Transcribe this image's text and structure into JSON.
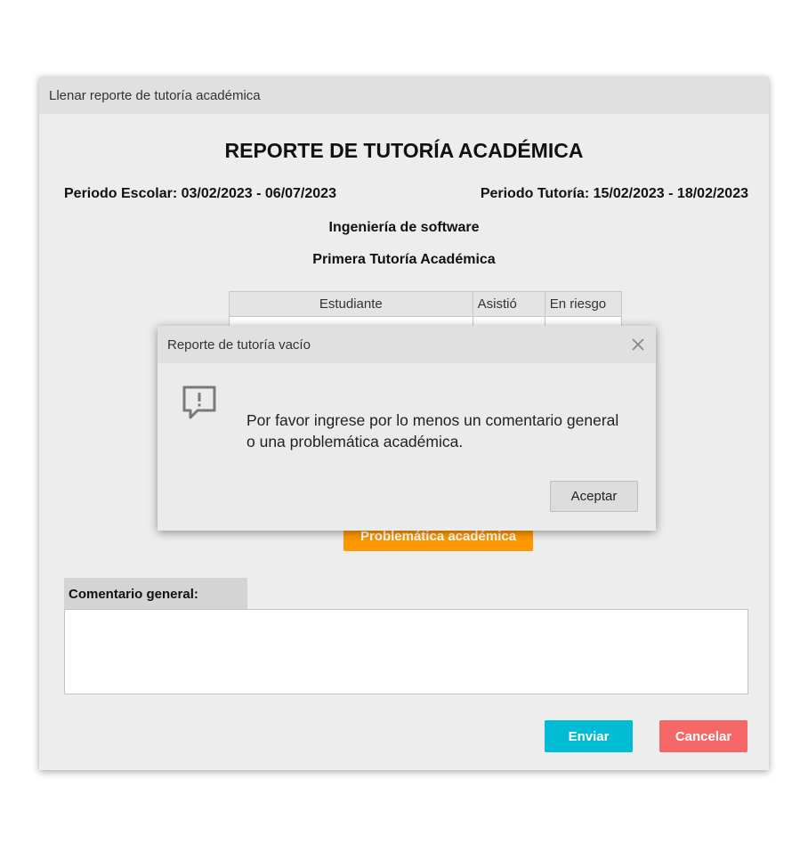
{
  "window": {
    "title": "Llenar reporte de tutoría académica"
  },
  "report": {
    "title": "REPORTE DE TUTORÍA ACADÉMICA",
    "school_period": "Periodo Escolar: 03/02/2023 - 06/07/2023",
    "tutoring_period": "Periodo Tutoría: 15/02/2023 - 18/02/2023",
    "program": "Ingeniería de software",
    "tutoring_name": "Primera Tutoría Académica",
    "table": {
      "columns": [
        "Estudiante",
        "Asistió",
        "En riesgo"
      ]
    },
    "problem_button_label": "Problemática académica",
    "comment_label": "Comentario general:",
    "comment_value": "",
    "send_label": "Enviar",
    "cancel_label": "Cancelar"
  },
  "dialog": {
    "title": "Reporte de tutoría vacío",
    "icon": "message-alert-icon",
    "close_icon": "close-icon",
    "message": "Por favor ingrese por lo menos un comentario general o una problemática académica.",
    "accept_label": "Aceptar"
  },
  "colors": {
    "send": "#00bcd4",
    "cancel": "#f66868",
    "problem": "#ff9800"
  }
}
